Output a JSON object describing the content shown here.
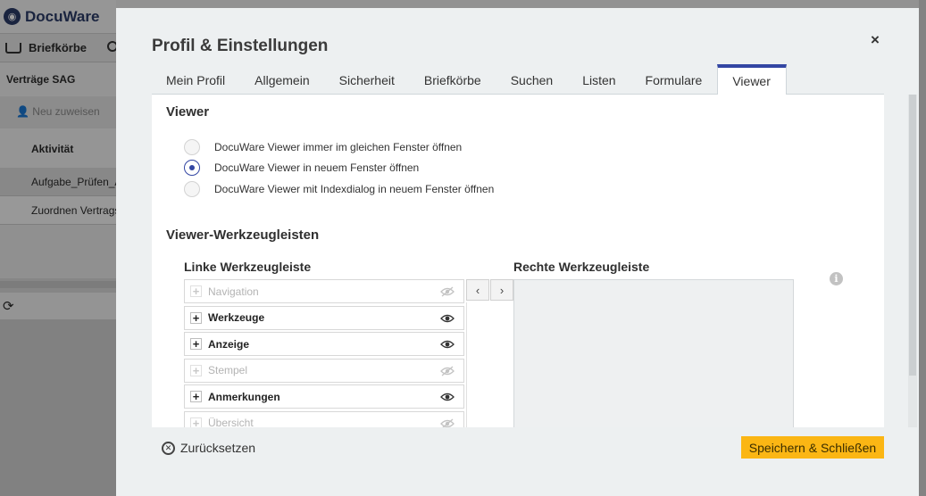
{
  "background": {
    "logo_text": "DocuWare",
    "tray_tab": "Briefkörbe",
    "sidebar_title": "Verträge SAG",
    "action_reassign": "Neu zuweisen",
    "column_activity": "Aktivität",
    "rows": [
      "Aufgabe_Prüfen_A",
      "Zuordnen Vertrags"
    ]
  },
  "dialog": {
    "title": "Profil & Einstellungen",
    "close_symbol": "×",
    "tabs": [
      {
        "label": "Mein Profil",
        "active": false
      },
      {
        "label": "Allgemein",
        "active": false
      },
      {
        "label": "Sicherheit",
        "active": false
      },
      {
        "label": "Briefkörbe",
        "active": false
      },
      {
        "label": "Suchen",
        "active": false
      },
      {
        "label": "Listen",
        "active": false
      },
      {
        "label": "Formulare",
        "active": false
      },
      {
        "label": "Viewer",
        "active": true
      }
    ],
    "viewer_section": {
      "title": "Viewer",
      "options": [
        {
          "label": "DocuWare Viewer immer im gleichen Fenster öffnen",
          "checked": false
        },
        {
          "label": "DocuWare Viewer in neuem Fenster öffnen",
          "checked": true
        },
        {
          "label": "DocuWare Viewer mit Indexdialog in neuem Fenster öffnen",
          "checked": false
        }
      ]
    },
    "toolbars_section": {
      "title": "Viewer-Werkzeugleisten",
      "left_title": "Linke Werkzeugleiste",
      "right_title": "Rechte Werkzeugleiste",
      "info_symbol": "i",
      "left_items": [
        {
          "label": "Navigation",
          "visible": false
        },
        {
          "label": "Werkzeuge",
          "visible": true
        },
        {
          "label": "Anzeige",
          "visible": true
        },
        {
          "label": "Stempel",
          "visible": false
        },
        {
          "label": "Anmerkungen",
          "visible": true
        },
        {
          "label": "Übersicht",
          "visible": false
        }
      ],
      "arrow_left": "‹",
      "arrow_right": "›",
      "right_items": []
    },
    "reset_label": "Zurücksetzen",
    "save_label": "Speichern & Schließen"
  },
  "colors": {
    "accent": "#3346a3",
    "save_button": "#fbb614",
    "dialog_bg": "#edf0f1"
  }
}
